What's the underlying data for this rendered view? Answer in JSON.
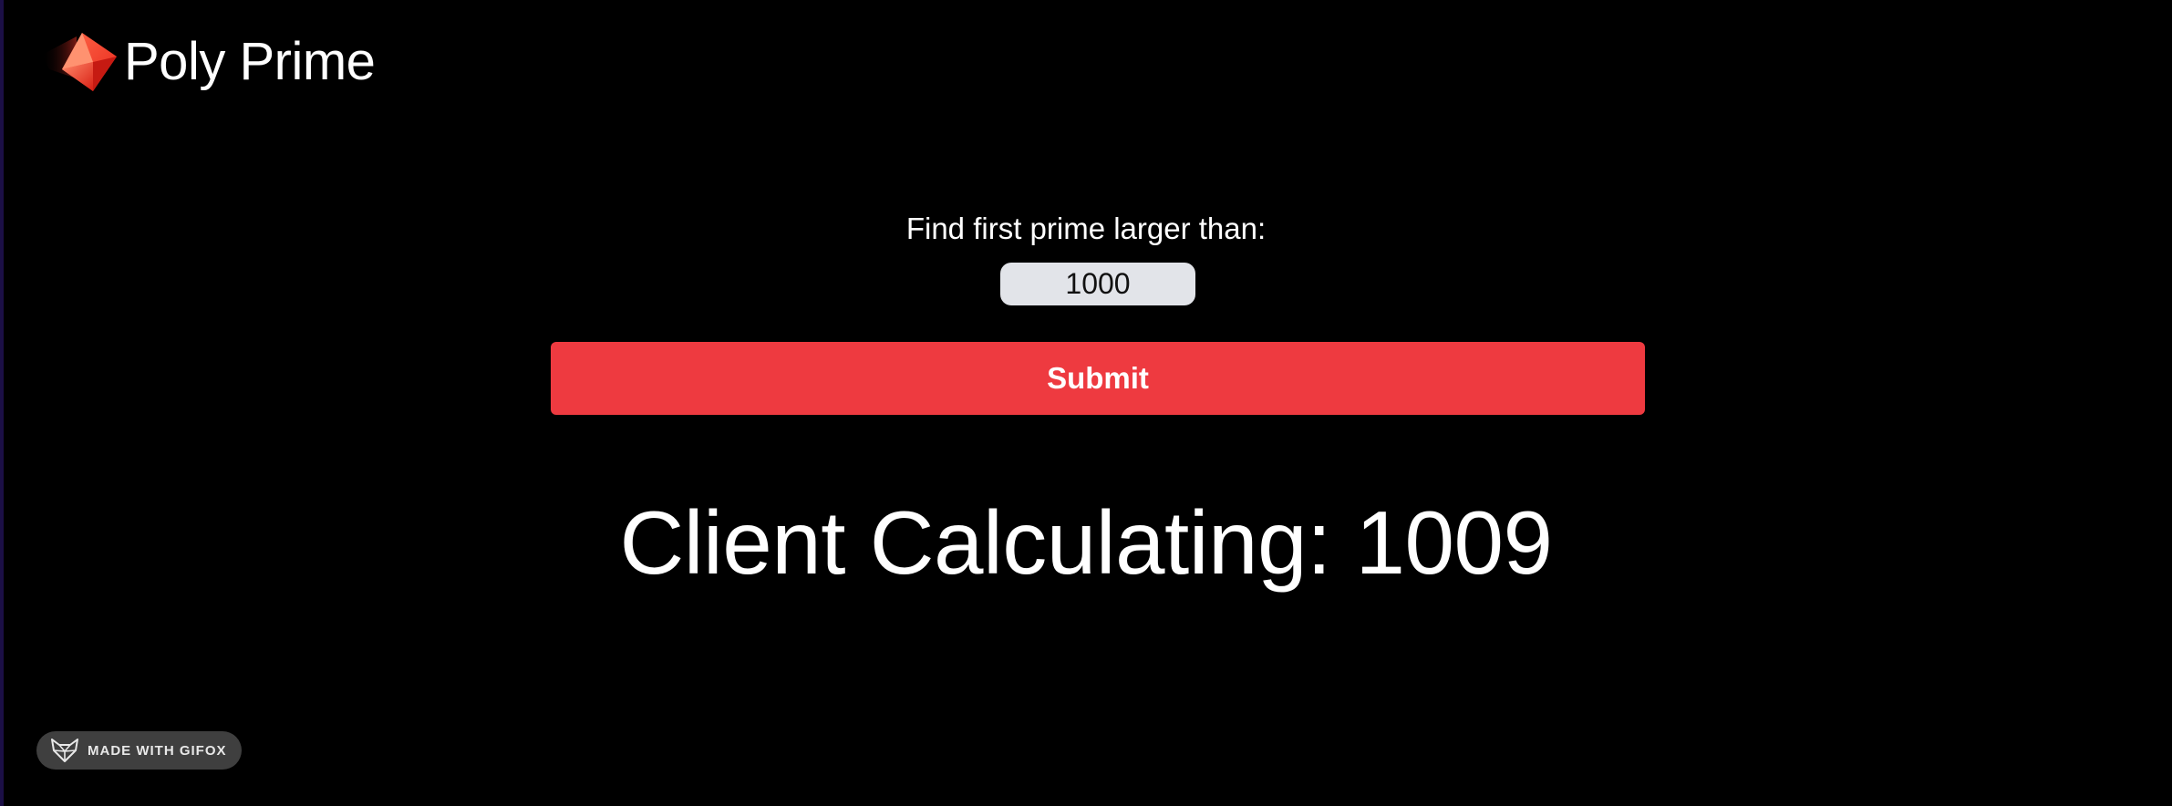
{
  "app": {
    "title": "Poly Prime",
    "logo_icon": "red-gem-icon"
  },
  "form": {
    "label": "Find first prime larger than:",
    "input_value": "1000",
    "submit_label": "Submit"
  },
  "result": {
    "prefix": "Client Calculating:",
    "value": "1009"
  },
  "badge": {
    "text": "MADE WITH GIFOX",
    "icon": "fox-icon"
  },
  "colors": {
    "background": "#000000",
    "accent": "#ee3a40",
    "input_bg": "#e2e4e9",
    "badge_bg": "#3f3f3f"
  }
}
